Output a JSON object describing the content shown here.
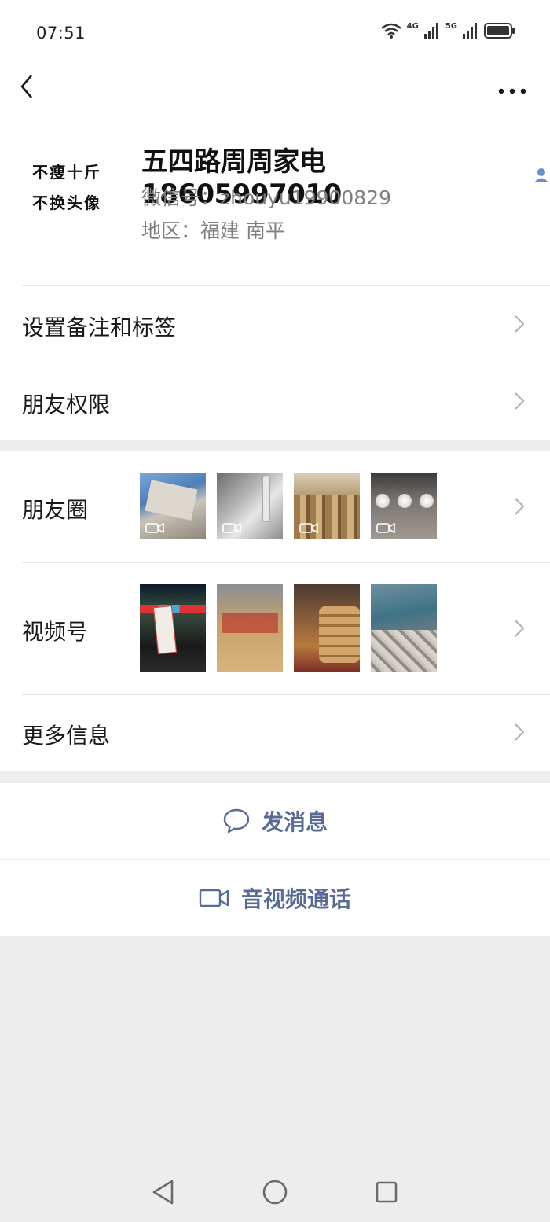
{
  "status_bar": {
    "time": "07:51",
    "network_1": "4G",
    "network_2": "5G"
  },
  "profile": {
    "avatar_text": [
      "不瘦十斤",
      "不换头像"
    ],
    "nickname": "五四路周周家电18605997010",
    "wechat_id": "微信号：zhouyu19900829",
    "region": "地区：福建  南平"
  },
  "menu": {
    "remark_tags": "设置备注和标签",
    "friend_permissions": "朋友权限",
    "moments": "朋友圈",
    "channels": "视频号",
    "more_info": "更多信息"
  },
  "moments_thumbs": [
    "box-package",
    "faucet",
    "snack-trays",
    "lamps"
  ],
  "channels_thumbs": [
    "ticket-night",
    "basketball-court",
    "steamer-food",
    "aerial-city"
  ],
  "actions": {
    "send_message": "发消息",
    "av_call": "音视频通话"
  },
  "colors": {
    "link": "#576b95",
    "background": "#ededed",
    "chevron": "#b2b2b2"
  },
  "icons": [
    "back-icon",
    "more-icon",
    "contact-icon",
    "chevron-right-icon",
    "video-icon",
    "chat-bubble-icon",
    "video-camera-icon"
  ]
}
